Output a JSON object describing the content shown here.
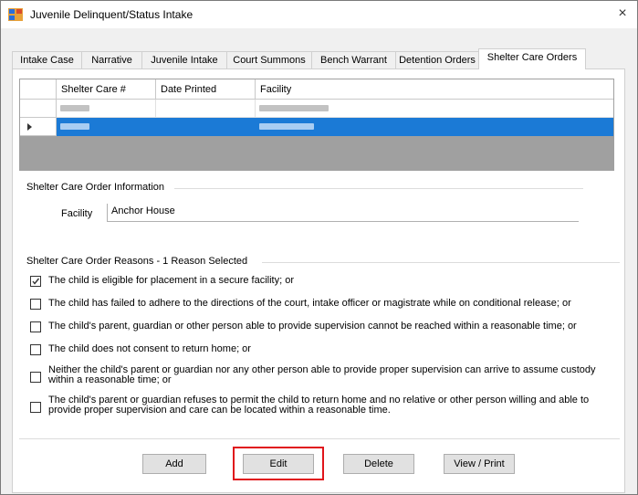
{
  "window": {
    "title": "Juvenile Delinquent/Status Intake",
    "close_label": "×"
  },
  "tabs": [
    "Intake Case",
    "Narrative",
    "Juvenile Intake",
    "Court Summons",
    "Bench Warrant",
    "Detention Orders",
    "Shelter Care Orders"
  ],
  "active_tab": "Shelter Care Orders",
  "grid": {
    "columns": [
      "Shelter Care #",
      "Date Printed",
      "Facility"
    ],
    "selected_row": 1
  },
  "info": {
    "legend": "Shelter Care Order Information",
    "facility_label": "Facility",
    "facility_value": "Anchor House"
  },
  "reasons": {
    "legend": "Shelter Care Order Reasons - 1 Reason Selected",
    "items": [
      {
        "checked": true,
        "lines": [
          "The child is eligible for placement in a secure facility; or"
        ]
      },
      {
        "checked": false,
        "lines": [
          "The child has failed to adhere to the directions of the court, intake officer or magistrate while on conditional release; or"
        ]
      },
      {
        "checked": false,
        "lines": [
          "The child's parent, guardian or other person able to provide supervision cannot be reached within a reasonable time; or"
        ]
      },
      {
        "checked": false,
        "lines": [
          "The child does not consent to return home; or"
        ]
      },
      {
        "checked": false,
        "lines": [
          "Neither the child's parent or guardian nor any other person able to provide proper supervision can arrive to assume custody",
          "within a reasonable time; or"
        ]
      },
      {
        "checked": false,
        "lines": [
          "The child's parent or guardian refuses to permit the child to return home and no relative or other person willing and able to",
          "provide proper supervision and care can be located within a reasonable time."
        ]
      }
    ]
  },
  "buttons": {
    "add": "Add",
    "edit": "Edit",
    "delete": "Delete",
    "view_print": "View / Print"
  }
}
